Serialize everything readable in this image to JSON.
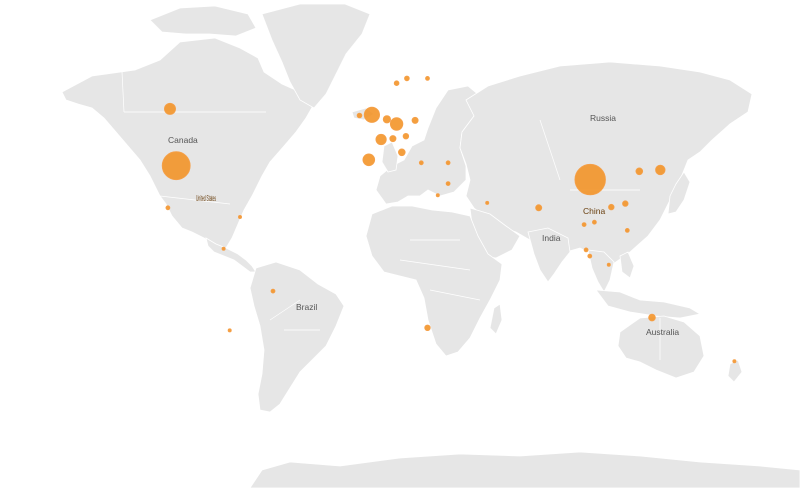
{
  "map": {
    "bubble_color": "#f28e1c",
    "land_color": "#e6e6e6",
    "background_color": "#ffffff",
    "labels": [
      {
        "id": "canada",
        "text": "Canada"
      },
      {
        "id": "usa",
        "text": "United States"
      },
      {
        "id": "brazil",
        "text": "Brazil"
      },
      {
        "id": "russia",
        "text": "Russia"
      },
      {
        "id": "china",
        "text": "China"
      },
      {
        "id": "india",
        "text": "India"
      },
      {
        "id": "australia",
        "text": "Australia"
      }
    ],
    "bubbles": [
      {
        "id": "usa",
        "lon": -97.0,
        "lat": 38.0,
        "size": 1.0
      },
      {
        "id": "china",
        "lon": 104.0,
        "lat": 33.0,
        "size": 1.2
      },
      {
        "id": "canada",
        "lon": -100.0,
        "lat": 55.0,
        "size": 0.16
      },
      {
        "id": "mexico",
        "lon": -101.0,
        "lat": 22.0,
        "size": 0.02
      },
      {
        "id": "brazil",
        "lon": -50.0,
        "lat": -14.0,
        "size": 0.02
      },
      {
        "id": "uk",
        "lon": -2.0,
        "lat": 53.5,
        "size": 0.3
      },
      {
        "id": "germany",
        "lon": 10.0,
        "lat": 51.0,
        "size": 0.2
      },
      {
        "id": "france",
        "lon": 2.5,
        "lat": 46.5,
        "size": 0.14
      },
      {
        "id": "spain",
        "lon": -3.5,
        "lat": 40.0,
        "size": 0.18
      },
      {
        "id": "italy",
        "lon": 12.5,
        "lat": 42.5,
        "size": 0.06
      },
      {
        "id": "netherlands",
        "lon": 5.3,
        "lat": 52.3,
        "size": 0.07
      },
      {
        "id": "poland",
        "lon": 19.0,
        "lat": 52.0,
        "size": 0.05
      },
      {
        "id": "switzerland",
        "lon": 8.2,
        "lat": 46.8,
        "size": 0.05
      },
      {
        "id": "austria",
        "lon": 14.5,
        "lat": 47.5,
        "size": 0.04
      },
      {
        "id": "ireland",
        "lon": -8.0,
        "lat": 53.3,
        "size": 0.03
      },
      {
        "id": "norway",
        "lon": 10.0,
        "lat": 61.0,
        "size": 0.03
      },
      {
        "id": "sweden",
        "lon": 15.0,
        "lat": 62.0,
        "size": 0.03
      },
      {
        "id": "finland",
        "lon": 25.0,
        "lat": 62.0,
        "size": 0.02
      },
      {
        "id": "greece",
        "lon": 22.0,
        "lat": 39.0,
        "size": 0.02
      },
      {
        "id": "turkey",
        "lon": 35.0,
        "lat": 39.0,
        "size": 0.02
      },
      {
        "id": "israel",
        "lon": 35.0,
        "lat": 31.5,
        "size": 0.02
      },
      {
        "id": "uae",
        "lon": 54.0,
        "lat": 24.0,
        "size": 0.01
      },
      {
        "id": "india",
        "lon": 79.0,
        "lat": 22.0,
        "size": 0.05
      },
      {
        "id": "south-korea",
        "lon": 127.8,
        "lat": 36.0,
        "size": 0.06
      },
      {
        "id": "japan",
        "lon": 138.0,
        "lat": 36.5,
        "size": 0.12
      },
      {
        "id": "taiwan",
        "lon": 121.0,
        "lat": 23.7,
        "size": 0.04
      },
      {
        "id": "hong-kong",
        "lon": 114.2,
        "lat": 22.3,
        "size": 0.04
      },
      {
        "id": "vietnam",
        "lon": 106.0,
        "lat": 16.0,
        "size": 0.02
      },
      {
        "id": "thailand",
        "lon": 101.0,
        "lat": 15.0,
        "size": 0.02
      },
      {
        "id": "philippines",
        "lon": 122.0,
        "lat": 12.5,
        "size": 0.02
      },
      {
        "id": "malaysia",
        "lon": 102.0,
        "lat": 4.0,
        "size": 0.02
      },
      {
        "id": "singapore",
        "lon": 103.8,
        "lat": 1.3,
        "size": 0.02
      },
      {
        "id": "indonesia",
        "lon": 113.0,
        "lat": -2.5,
        "size": 0.01
      },
      {
        "id": "australia",
        "lon": 134.0,
        "lat": -25.0,
        "size": 0.06
      },
      {
        "id": "new-zealand",
        "lon": 174.0,
        "lat": -41.0,
        "size": 0.01
      },
      {
        "id": "south-africa",
        "lon": 25.0,
        "lat": -29.0,
        "size": 0.04
      },
      {
        "id": "egypt",
        "lon": 30.0,
        "lat": 27.0,
        "size": 0.01
      },
      {
        "id": "caribbean",
        "lon": -66.0,
        "lat": 18.2,
        "size": 0.01
      },
      {
        "id": "colombia",
        "lon": -74.0,
        "lat": 4.5,
        "size": 0.01
      },
      {
        "id": "chile",
        "lon": -71.0,
        "lat": -30.0,
        "size": 0.01
      }
    ]
  }
}
